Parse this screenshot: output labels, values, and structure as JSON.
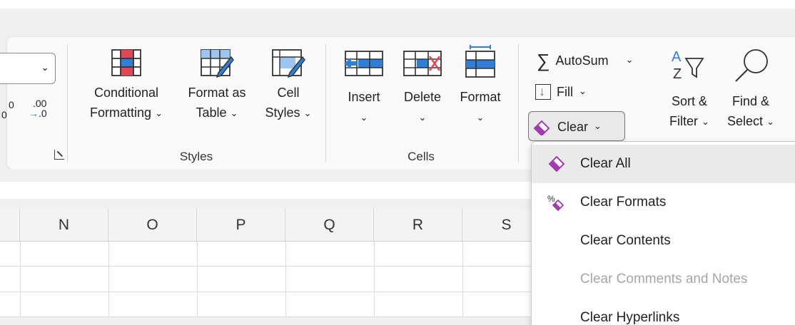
{
  "ribbon": {
    "styles_group": {
      "label": "Styles",
      "conditional_formatting": {
        "line1": "Conditional",
        "line2": "Formatting"
      },
      "format_as_table": {
        "line1": "Format as",
        "line2": "Table"
      },
      "cell_styles": {
        "line1": "Cell",
        "line2": "Styles"
      }
    },
    "cells_group": {
      "label": "Cells",
      "insert": "Insert",
      "delete": "Delete",
      "format": "Format"
    },
    "editing_group": {
      "autosum": "AutoSum",
      "fill": "Fill",
      "clear": "Clear",
      "sort_filter": {
        "line1": "Sort &",
        "line2": "Filter"
      },
      "find_select": {
        "line1": "Find &",
        "line2": "Select"
      }
    },
    "number_group": {
      "increase_decimal": ".00",
      "decrease_decimal": ".00",
      "inc_sub": "0",
      "dec_sub": ".0"
    }
  },
  "sheet": {
    "columns": [
      "N",
      "O",
      "P",
      "Q",
      "R",
      "S"
    ]
  },
  "clear_menu": {
    "items": [
      {
        "label": "Clear All",
        "icon": "eraser-icon",
        "enabled": true,
        "hover": true
      },
      {
        "label": "Clear Formats",
        "icon": "clear-formats-icon",
        "enabled": true,
        "hover": false
      },
      {
        "label": "Clear Contents",
        "icon": "",
        "enabled": true,
        "hover": false
      },
      {
        "label": "Clear Comments and Notes",
        "icon": "",
        "enabled": false,
        "hover": false
      },
      {
        "label": "Clear Hyperlinks",
        "icon": "",
        "enabled": true,
        "hover": false
      }
    ]
  },
  "colors": {
    "accent_blue": "#2f7fd6",
    "accent_red": "#e0485a",
    "eraser_purple": "#a23bb2"
  }
}
